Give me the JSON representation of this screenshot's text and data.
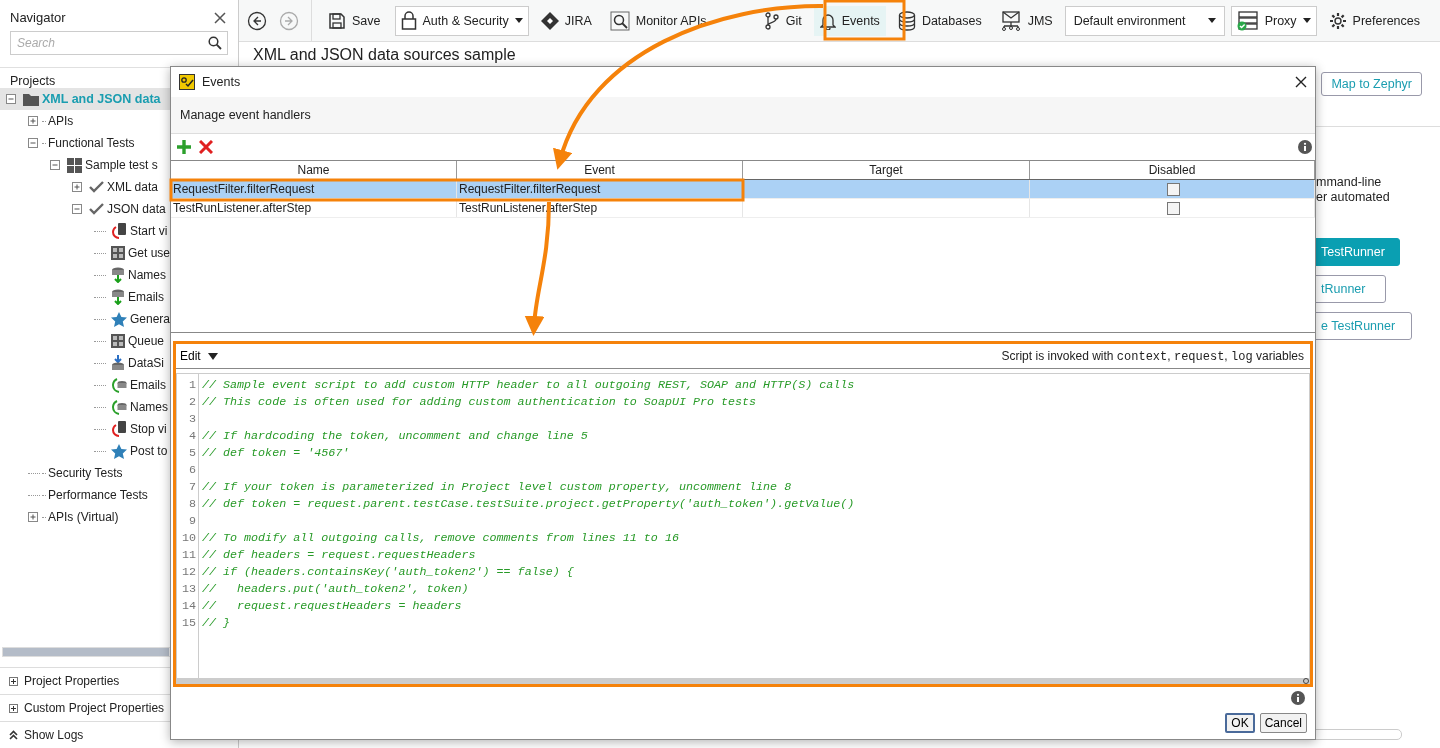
{
  "navigator": {
    "title": "Navigator",
    "search": {
      "placeholder": "Search"
    },
    "projects_label": "Projects",
    "tree": [
      {
        "label": "XML and JSON data",
        "kind": "project",
        "expanded": true,
        "selected": true,
        "children": [
          {
            "label": "APIs",
            "kind": "folder",
            "expanded": false,
            "selected": false
          },
          {
            "label": "Functional Tests",
            "kind": "folder",
            "expanded": true,
            "selected": false,
            "children": [
              {
                "label": "Sample test s",
                "kind": "suite",
                "expanded": true,
                "selected": false,
                "children": [
                  {
                    "label": "XML data",
                    "kind": "case",
                    "expanded": false,
                    "selected": false
                  },
                  {
                    "label": "JSON data",
                    "kind": "case",
                    "expanded": true,
                    "selected": false,
                    "children": [
                      {
                        "label": "Start vi",
                        "kind": "virt-start",
                        "selected": false
                      },
                      {
                        "label": "Get use",
                        "kind": "rest",
                        "selected": false
                      },
                      {
                        "label": "Names",
                        "kind": "source",
                        "selected": false
                      },
                      {
                        "label": "Emails",
                        "kind": "source",
                        "selected": false
                      },
                      {
                        "label": "Genera",
                        "kind": "star",
                        "selected": false
                      },
                      {
                        "label": "Queue",
                        "kind": "rest",
                        "selected": false
                      },
                      {
                        "label": "DataSi",
                        "kind": "sink",
                        "selected": false
                      },
                      {
                        "label": "Emails",
                        "kind": "loop",
                        "selected": false
                      },
                      {
                        "label": "Names",
                        "kind": "loop",
                        "selected": false
                      },
                      {
                        "label": "Stop vi",
                        "kind": "virt-stop",
                        "selected": false
                      },
                      {
                        "label": "Post to",
                        "kind": "star",
                        "selected": false
                      }
                    ]
                  }
                ]
              }
            ]
          },
          {
            "label": "Security Tests",
            "kind": "folder",
            "selected": false
          },
          {
            "label": "Performance Tests",
            "kind": "folder",
            "selected": false
          },
          {
            "label": "APIs (Virtual)",
            "kind": "folder",
            "expanded": false,
            "selected": false
          }
        ]
      }
    ],
    "sections": [
      {
        "label": "Project Properties",
        "expanded": false
      },
      {
        "label": "Custom Project Properties",
        "expanded": false
      }
    ],
    "show_logs": "Show Logs"
  },
  "toolbar": {
    "back": {
      "disabled": false
    },
    "forward": {
      "disabled": true
    },
    "items": [
      {
        "kind": "save",
        "label": "Save",
        "selected": false
      },
      {
        "kind": "auth",
        "label": "Auth & Security",
        "selected": false
      },
      {
        "kind": "jira",
        "label": "JIRA",
        "selected": false
      },
      {
        "kind": "monitor",
        "label": "Monitor APIs",
        "selected": false
      },
      {
        "kind": "git",
        "label": "Git",
        "selected": false
      },
      {
        "kind": "events",
        "label": "Events",
        "selected": true
      },
      {
        "kind": "databases",
        "label": "Databases",
        "selected": false
      },
      {
        "kind": "jms",
        "label": "JMS",
        "selected": false
      },
      {
        "kind": "environment",
        "label": "Default environment",
        "selected": false
      },
      {
        "kind": "proxy",
        "label": "Proxy",
        "selected": false
      },
      {
        "kind": "preferences",
        "label": "Preferences",
        "selected": false
      }
    ]
  },
  "main": {
    "title": "XML and JSON data sources sample",
    "zephyr_button": "Map to Zephyr",
    "texts": [
      "mmand-line",
      "er automated"
    ],
    "buttons": [
      {
        "label": "TestRunner",
        "primary": true
      },
      {
        "label": "tRunner",
        "primary": false
      },
      {
        "label": "e TestRunner",
        "primary": false
      }
    ]
  },
  "dialog": {
    "title": "Events",
    "subtitle": "Manage event handlers",
    "columns": [
      "Name",
      "Event",
      "Target",
      "Disabled"
    ],
    "rows": [
      {
        "name": "RequestFilter.filterRequest",
        "event": "RequestFilter.filterRequest",
        "disabled": false,
        "selected": true
      },
      {
        "name": "TestRunListener.afterStep",
        "event": "TestRunListener.afterStep",
        "disabled": false,
        "selected": false
      }
    ],
    "editor": {
      "menu": "Edit",
      "hint_parts": [
        {
          "text": "Script is invoked with ",
          "code": false
        },
        {
          "text": "context",
          "code": true
        },
        {
          "text": ", ",
          "code": false
        },
        {
          "text": "request",
          "code": true
        },
        {
          "text": ", ",
          "code": false
        },
        {
          "text": "log",
          "code": true
        },
        {
          "text": " variables",
          "code": false
        }
      ],
      "lines": [
        {
          "number": "1",
          "code": "// Sample event script to add custom HTTP header to all outgoing REST, SOAP and HTTP(S) calls"
        },
        {
          "number": "2",
          "code": "// This code is often used for adding custom authentication to SoapUI Pro tests"
        },
        {
          "number": "3"
        },
        {
          "number": "4",
          "code": "// If hardcoding the token, uncomment and change line 5"
        },
        {
          "number": "5",
          "code": "// def token = '4567'"
        },
        {
          "number": "6"
        },
        {
          "number": "7",
          "code": "// If your token is parameterized in Project level custom property, uncomment line 8"
        },
        {
          "number": "8",
          "code": "// def token = request.parent.testCase.testSuite.project.getProperty('auth_token').getValue()"
        },
        {
          "number": "9"
        },
        {
          "number": "10",
          "code": "// To modify all outgoing calls, remove comments from lines 11 to 16"
        },
        {
          "number": "11",
          "code": "// def headers = request.requestHeaders"
        },
        {
          "number": "12",
          "code": "// if (headers.containsKey('auth_token2') == false) {"
        },
        {
          "number": "13",
          "code": "//   headers.put('auth_token2', token)"
        },
        {
          "number": "14",
          "code": "//   request.requestHeaders = headers"
        },
        {
          "number": "15",
          "code": "// }"
        }
      ]
    },
    "buttons": [
      {
        "label": "OK",
        "default": true
      },
      {
        "label": "Cancel",
        "default": false
      }
    ]
  }
}
